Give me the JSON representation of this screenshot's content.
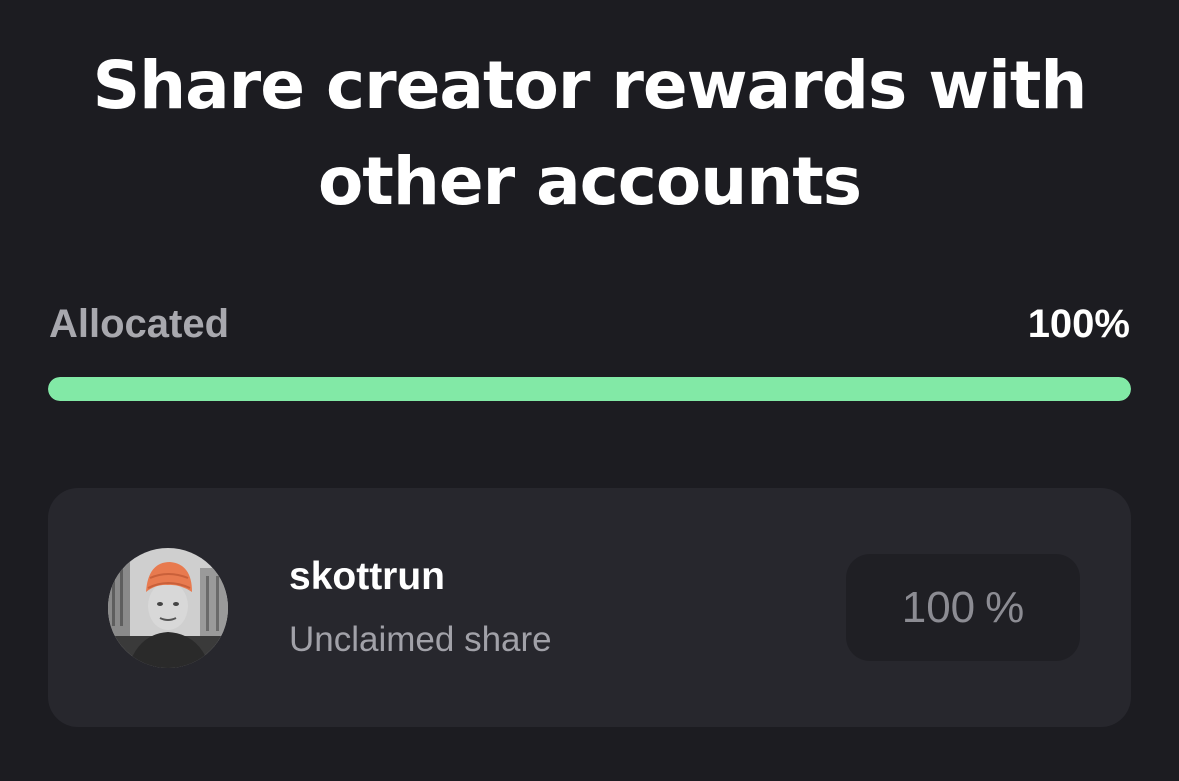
{
  "header": {
    "title_line1": "Share creator rewards with",
    "title_line2": "other accounts"
  },
  "allocation": {
    "label": "Allocated",
    "value_text": "100%",
    "progress_fraction": 1.0,
    "bar_color": "#82e9a6"
  },
  "recipients": [
    {
      "username": "skottrun",
      "status": "Unclaimed share",
      "share_value": "100",
      "share_unit": "%",
      "avatar_icon": "user-avatar-photo"
    }
  ]
}
